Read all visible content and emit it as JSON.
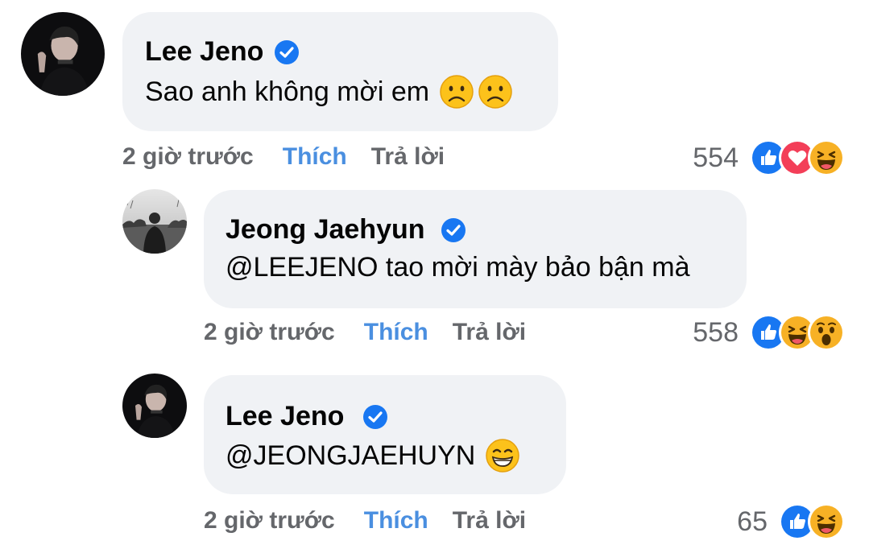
{
  "comments": [
    {
      "author": "Lee Jeno",
      "text": "Sao anh không mời em",
      "emojis": [
        "frowning-face",
        "frowning-face"
      ],
      "time": "2 giờ trước",
      "like_label": "Thích",
      "reply_label": "Trả lời",
      "reaction_count": "554",
      "reactions": [
        "like",
        "love",
        "haha"
      ]
    },
    {
      "author": "Jeong Jaehyun",
      "text": "@LEEJENO tao mời mày bảo bận mà",
      "emojis": [],
      "time": "2 giờ trước",
      "like_label": "Thích",
      "reply_label": "Trả lời",
      "reaction_count": "558",
      "reactions": [
        "like",
        "haha",
        "wow"
      ]
    },
    {
      "author": "Lee Jeno",
      "text": "@JEONGJAEHUYN",
      "emojis": [
        "grinning-face"
      ],
      "time": "2 giờ trước",
      "like_label": "Thích",
      "reply_label": "Trả lời",
      "reaction_count": "65",
      "reactions": [
        "like",
        "haha"
      ]
    }
  ],
  "colors": {
    "like_blue": "#4a8fe0",
    "meta_gray": "#65676b",
    "bubble_bg": "#f0f2f5",
    "verified_blue": "#1877f2"
  }
}
